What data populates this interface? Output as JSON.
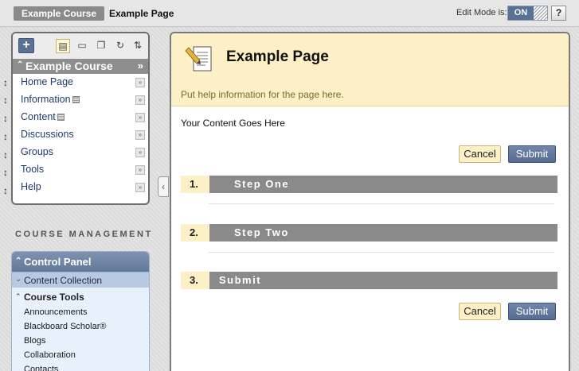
{
  "breadcrumb": {
    "course": "Example Course",
    "page": "Example Page"
  },
  "edit_mode": {
    "label": "Edit Mode is:",
    "state": "ON",
    "help": "?"
  },
  "course_menu": {
    "add_label": "+",
    "title": "Example Course",
    "items": [
      {
        "label": "Home Page"
      },
      {
        "label": "Information"
      },
      {
        "label": "Content"
      },
      {
        "label": "Discussions"
      },
      {
        "label": "Groups"
      },
      {
        "label": "Tools"
      },
      {
        "label": "Help"
      }
    ]
  },
  "course_management": {
    "heading": "COURSE MANAGEMENT",
    "control_panel": "Control Panel",
    "content_collection": "Content Collection",
    "course_tools": {
      "label": "Course Tools",
      "items": [
        "Announcements",
        "Blackboard Scholar®",
        "Blogs",
        "Collaboration",
        "Contacts"
      ]
    }
  },
  "page": {
    "title": "Example Page",
    "help_text": "Put help information for the page here.",
    "content_text": "Your Content Goes Here",
    "cancel_label": "Cancel",
    "submit_label": "Submit",
    "steps": [
      {
        "number": "1.",
        "title": "Step One"
      },
      {
        "number": "2.",
        "title": "Step Two"
      },
      {
        "number": "3.",
        "title": "Submit"
      }
    ]
  }
}
